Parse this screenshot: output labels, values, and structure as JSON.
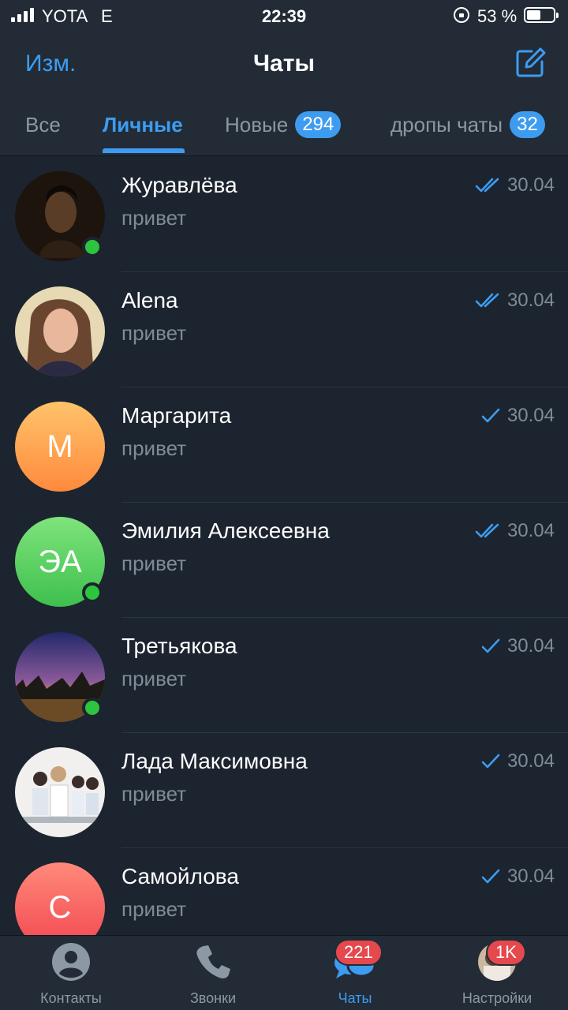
{
  "status_bar": {
    "carrier": "YOTA",
    "network": "E",
    "time": "22:39",
    "battery": "53 %",
    "battery_level": 0.53
  },
  "header": {
    "edit_label": "Изм.",
    "title": "Чаты",
    "compose_icon": "compose-icon"
  },
  "tabs": [
    {
      "label": "Все",
      "badge": null,
      "active": false
    },
    {
      "label": "Личные",
      "badge": null,
      "active": true
    },
    {
      "label": "Новые",
      "badge": "294",
      "active": false
    },
    {
      "label": "дропы чаты",
      "badge": "32",
      "active": false
    }
  ],
  "chats": [
    {
      "name": "Журавлёва",
      "preview": "привет",
      "date": "30.04",
      "status": "read",
      "online": true,
      "avatar_type": "photo",
      "avatar_icon": "portrait-photo"
    },
    {
      "name": "Alena",
      "preview": "привет",
      "date": "30.04",
      "status": "read",
      "online": false,
      "avatar_type": "photo",
      "avatar_icon": "portrait-photo"
    },
    {
      "name": "Маргарита",
      "preview": "привет",
      "date": "30.04",
      "status": "sent",
      "online": false,
      "avatar_type": "initials",
      "initials": "М",
      "avatar_colors": [
        "#ffc36a",
        "#ff8a3d"
      ]
    },
    {
      "name": "Эмилия Алексеевна",
      "preview": "привет",
      "date": "30.04",
      "status": "read",
      "online": true,
      "avatar_type": "initials",
      "initials": "ЭА",
      "avatar_colors": [
        "#7fe37c",
        "#3ec04e"
      ]
    },
    {
      "name": "Третьякова",
      "preview": "привет",
      "date": "30.04",
      "status": "sent",
      "online": true,
      "avatar_type": "photo",
      "avatar_icon": "sunset-photo"
    },
    {
      "name": "Лада Максимовна",
      "preview": "привет",
      "date": "30.04",
      "status": "sent",
      "online": false,
      "avatar_type": "photo",
      "avatar_icon": "family-photo"
    },
    {
      "name": "Самойлова",
      "preview": "привет",
      "date": "30.04",
      "status": "sent",
      "online": false,
      "avatar_type": "initials",
      "initials": "С",
      "avatar_colors": [
        "#ff8a7a",
        "#f2454f"
      ]
    }
  ],
  "tab_bar": [
    {
      "label": "Контакты",
      "icon": "person-icon",
      "badge": null,
      "active": false
    },
    {
      "label": "Звонки",
      "icon": "phone-icon",
      "badge": null,
      "active": false
    },
    {
      "label": "Чаты",
      "icon": "chat-bubbles-icon",
      "badge": "221",
      "active": true
    },
    {
      "label": "Настройки",
      "icon": "profile-avatar-icon",
      "badge": "1K",
      "active": false
    }
  ],
  "colors": {
    "accent": "#3d9cf0",
    "background": "#1c242f",
    "bar": "#222b36",
    "online": "#2dc53d",
    "badge_red": "#e5484d"
  }
}
